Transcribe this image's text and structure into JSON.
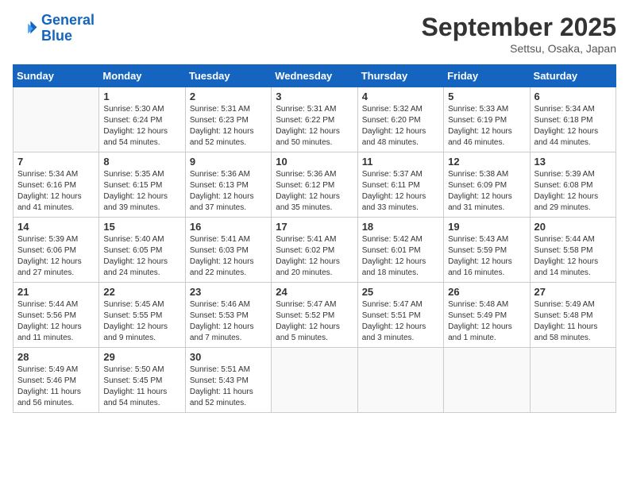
{
  "header": {
    "logo_line1": "General",
    "logo_line2": "Blue",
    "month": "September 2025",
    "location": "Settsu, Osaka, Japan"
  },
  "weekdays": [
    "Sunday",
    "Monday",
    "Tuesday",
    "Wednesday",
    "Thursday",
    "Friday",
    "Saturday"
  ],
  "weeks": [
    [
      {
        "day": "",
        "empty": true
      },
      {
        "day": "1",
        "sunrise": "5:30 AM",
        "sunset": "6:24 PM",
        "daylight": "12 hours and 54 minutes."
      },
      {
        "day": "2",
        "sunrise": "5:31 AM",
        "sunset": "6:23 PM",
        "daylight": "12 hours and 52 minutes."
      },
      {
        "day": "3",
        "sunrise": "5:31 AM",
        "sunset": "6:22 PM",
        "daylight": "12 hours and 50 minutes."
      },
      {
        "day": "4",
        "sunrise": "5:32 AM",
        "sunset": "6:20 PM",
        "daylight": "12 hours and 48 minutes."
      },
      {
        "day": "5",
        "sunrise": "5:33 AM",
        "sunset": "6:19 PM",
        "daylight": "12 hours and 46 minutes."
      },
      {
        "day": "6",
        "sunrise": "5:34 AM",
        "sunset": "6:18 PM",
        "daylight": "12 hours and 44 minutes."
      }
    ],
    [
      {
        "day": "7",
        "sunrise": "5:34 AM",
        "sunset": "6:16 PM",
        "daylight": "12 hours and 41 minutes."
      },
      {
        "day": "8",
        "sunrise": "5:35 AM",
        "sunset": "6:15 PM",
        "daylight": "12 hours and 39 minutes."
      },
      {
        "day": "9",
        "sunrise": "5:36 AM",
        "sunset": "6:13 PM",
        "daylight": "12 hours and 37 minutes."
      },
      {
        "day": "10",
        "sunrise": "5:36 AM",
        "sunset": "6:12 PM",
        "daylight": "12 hours and 35 minutes."
      },
      {
        "day": "11",
        "sunrise": "5:37 AM",
        "sunset": "6:11 PM",
        "daylight": "12 hours and 33 minutes."
      },
      {
        "day": "12",
        "sunrise": "5:38 AM",
        "sunset": "6:09 PM",
        "daylight": "12 hours and 31 minutes."
      },
      {
        "day": "13",
        "sunrise": "5:39 AM",
        "sunset": "6:08 PM",
        "daylight": "12 hours and 29 minutes."
      }
    ],
    [
      {
        "day": "14",
        "sunrise": "5:39 AM",
        "sunset": "6:06 PM",
        "daylight": "12 hours and 27 minutes."
      },
      {
        "day": "15",
        "sunrise": "5:40 AM",
        "sunset": "6:05 PM",
        "daylight": "12 hours and 24 minutes."
      },
      {
        "day": "16",
        "sunrise": "5:41 AM",
        "sunset": "6:03 PM",
        "daylight": "12 hours and 22 minutes."
      },
      {
        "day": "17",
        "sunrise": "5:41 AM",
        "sunset": "6:02 PM",
        "daylight": "12 hours and 20 minutes."
      },
      {
        "day": "18",
        "sunrise": "5:42 AM",
        "sunset": "6:01 PM",
        "daylight": "12 hours and 18 minutes."
      },
      {
        "day": "19",
        "sunrise": "5:43 AM",
        "sunset": "5:59 PM",
        "daylight": "12 hours and 16 minutes."
      },
      {
        "day": "20",
        "sunrise": "5:44 AM",
        "sunset": "5:58 PM",
        "daylight": "12 hours and 14 minutes."
      }
    ],
    [
      {
        "day": "21",
        "sunrise": "5:44 AM",
        "sunset": "5:56 PM",
        "daylight": "12 hours and 11 minutes."
      },
      {
        "day": "22",
        "sunrise": "5:45 AM",
        "sunset": "5:55 PM",
        "daylight": "12 hours and 9 minutes."
      },
      {
        "day": "23",
        "sunrise": "5:46 AM",
        "sunset": "5:53 PM",
        "daylight": "12 hours and 7 minutes."
      },
      {
        "day": "24",
        "sunrise": "5:47 AM",
        "sunset": "5:52 PM",
        "daylight": "12 hours and 5 minutes."
      },
      {
        "day": "25",
        "sunrise": "5:47 AM",
        "sunset": "5:51 PM",
        "daylight": "12 hours and 3 minutes."
      },
      {
        "day": "26",
        "sunrise": "5:48 AM",
        "sunset": "5:49 PM",
        "daylight": "12 hours and 1 minute."
      },
      {
        "day": "27",
        "sunrise": "5:49 AM",
        "sunset": "5:48 PM",
        "daylight": "11 hours and 58 minutes."
      }
    ],
    [
      {
        "day": "28",
        "sunrise": "5:49 AM",
        "sunset": "5:46 PM",
        "daylight": "11 hours and 56 minutes."
      },
      {
        "day": "29",
        "sunrise": "5:50 AM",
        "sunset": "5:45 PM",
        "daylight": "11 hours and 54 minutes."
      },
      {
        "day": "30",
        "sunrise": "5:51 AM",
        "sunset": "5:43 PM",
        "daylight": "11 hours and 52 minutes."
      },
      {
        "day": "",
        "empty": true
      },
      {
        "day": "",
        "empty": true
      },
      {
        "day": "",
        "empty": true
      },
      {
        "day": "",
        "empty": true
      }
    ]
  ]
}
